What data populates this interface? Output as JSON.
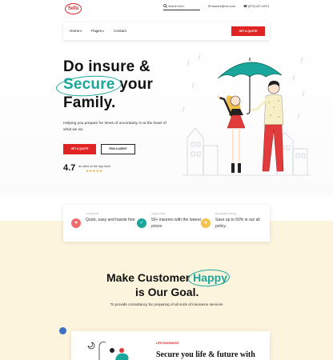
{
  "brand": {
    "logo_text": "Sefu"
  },
  "topbar": {
    "search_placeholder": "Search here..",
    "email": "elsoure@mc.com",
    "phone": "(879) 427-4974"
  },
  "nav": {
    "items": [
      {
        "label": "Home"
      },
      {
        "label": "Pages"
      },
      {
        "label": "Contact"
      }
    ],
    "cta_label": "GET A QUOTE"
  },
  "hero": {
    "line1": "Do insure &",
    "line2_accent": "Secure",
    "line2_rest": "your",
    "line3": "Family.",
    "description": "Helping you prepare for times of uncertainty is at the heart of what we do.",
    "primary_button": "GET A QUOTE",
    "secondary_button": "FIND A AGENT",
    "rating_value": "4.7",
    "rating_text": "as rated on the app store",
    "stars": "★★★★★"
  },
  "features": [
    {
      "small": "Your Benefit",
      "text": "Quick, easy and hassle free",
      "color": "#ef6b6b",
      "icon": "heart-icon",
      "glyph": "♥"
    },
    {
      "small": "Largest Team",
      "text": "50+ insurers with the lowest prices",
      "color": "#1aa69a",
      "icon": "check-icon",
      "glyph": "✓"
    },
    {
      "small": "Remarkable Saving",
      "text": "Save up to 50% in our all policy.",
      "color": "#f5c24b",
      "icon": "star-icon",
      "glyph": "★"
    }
  ],
  "goal": {
    "line1_start": "Make Customer",
    "line1_accent": "Happy",
    "line2": "is Our Goal.",
    "subtitle": "To provide consultancy for preparing of all sorts of insurance services"
  },
  "life": {
    "label": "LIFE INSURANCE",
    "title": "Secure you life & future with"
  },
  "colors": {
    "accent": "#1aa69a",
    "brand_red": "#e02424",
    "cream": "#fdf4dd"
  }
}
